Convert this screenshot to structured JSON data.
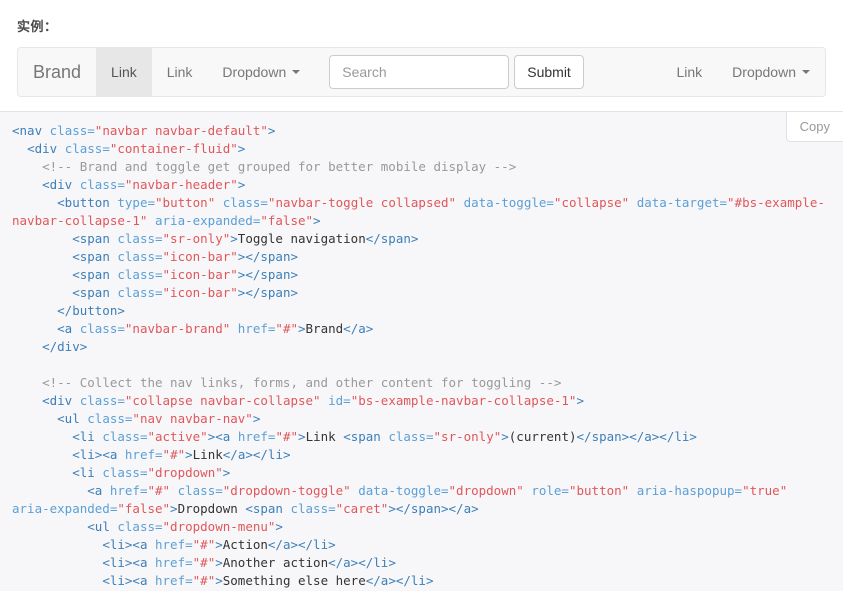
{
  "intro": {
    "label": "实例："
  },
  "navbar": {
    "brand": "Brand",
    "left_items": [
      {
        "label": "Link",
        "active": true,
        "caret": false
      },
      {
        "label": "Link",
        "active": false,
        "caret": false
      },
      {
        "label": "Dropdown",
        "active": false,
        "caret": true
      }
    ],
    "form": {
      "search_placeholder": "Search",
      "search_value": "",
      "submit_label": "Submit"
    },
    "right_items": [
      {
        "label": "Link",
        "active": false,
        "caret": false
      },
      {
        "label": "Dropdown",
        "active": false,
        "caret": true
      }
    ]
  },
  "code_panel": {
    "copy_label": "Copy",
    "language": "html",
    "lines": [
      [
        {
          "t": "tag",
          "s": "<nav "
        },
        {
          "t": "attr",
          "s": "class="
        },
        {
          "t": "val",
          "s": "\"navbar navbar-default\""
        },
        {
          "t": "tag",
          "s": ">"
        }
      ],
      [
        {
          "t": "txt",
          "s": "  "
        },
        {
          "t": "tag",
          "s": "<div "
        },
        {
          "t": "attr",
          "s": "class="
        },
        {
          "t": "val",
          "s": "\"container-fluid\""
        },
        {
          "t": "tag",
          "s": ">"
        }
      ],
      [
        {
          "t": "cmt",
          "s": "    <!-- Brand and toggle get grouped for better mobile display -->"
        }
      ],
      [
        {
          "t": "txt",
          "s": "    "
        },
        {
          "t": "tag",
          "s": "<div "
        },
        {
          "t": "attr",
          "s": "class="
        },
        {
          "t": "val",
          "s": "\"navbar-header\""
        },
        {
          "t": "tag",
          "s": ">"
        }
      ],
      [
        {
          "t": "txt",
          "s": "      "
        },
        {
          "t": "tag",
          "s": "<button "
        },
        {
          "t": "attr",
          "s": "type="
        },
        {
          "t": "val",
          "s": "\"button\""
        },
        {
          "t": "txt",
          "s": " "
        },
        {
          "t": "attr",
          "s": "class="
        },
        {
          "t": "val",
          "s": "\"navbar-toggle collapsed\""
        },
        {
          "t": "txt",
          "s": " "
        },
        {
          "t": "attr",
          "s": "data-toggle="
        },
        {
          "t": "val",
          "s": "\"collapse\""
        },
        {
          "t": "txt",
          "s": " "
        },
        {
          "t": "attr",
          "s": "data-target="
        },
        {
          "t": "val",
          "s": "\"#bs-example-navbar-collapse-1\""
        },
        {
          "t": "txt",
          "s": " "
        },
        {
          "t": "attr",
          "s": "aria-expanded="
        },
        {
          "t": "val",
          "s": "\"false\""
        },
        {
          "t": "tag",
          "s": ">"
        }
      ],
      [
        {
          "t": "txt",
          "s": "        "
        },
        {
          "t": "tag",
          "s": "<span "
        },
        {
          "t": "attr",
          "s": "class="
        },
        {
          "t": "val",
          "s": "\"sr-only\""
        },
        {
          "t": "tag",
          "s": ">"
        },
        {
          "t": "txt",
          "s": "Toggle navigation"
        },
        {
          "t": "tag",
          "s": "</span>"
        }
      ],
      [
        {
          "t": "txt",
          "s": "        "
        },
        {
          "t": "tag",
          "s": "<span "
        },
        {
          "t": "attr",
          "s": "class="
        },
        {
          "t": "val",
          "s": "\"icon-bar\""
        },
        {
          "t": "tag",
          "s": "></span>"
        }
      ],
      [
        {
          "t": "txt",
          "s": "        "
        },
        {
          "t": "tag",
          "s": "<span "
        },
        {
          "t": "attr",
          "s": "class="
        },
        {
          "t": "val",
          "s": "\"icon-bar\""
        },
        {
          "t": "tag",
          "s": "></span>"
        }
      ],
      [
        {
          "t": "txt",
          "s": "        "
        },
        {
          "t": "tag",
          "s": "<span "
        },
        {
          "t": "attr",
          "s": "class="
        },
        {
          "t": "val",
          "s": "\"icon-bar\""
        },
        {
          "t": "tag",
          "s": "></span>"
        }
      ],
      [
        {
          "t": "txt",
          "s": "      "
        },
        {
          "t": "tag",
          "s": "</button>"
        }
      ],
      [
        {
          "t": "txt",
          "s": "      "
        },
        {
          "t": "tag",
          "s": "<a "
        },
        {
          "t": "attr",
          "s": "class="
        },
        {
          "t": "val",
          "s": "\"navbar-brand\""
        },
        {
          "t": "txt",
          "s": " "
        },
        {
          "t": "attr",
          "s": "href="
        },
        {
          "t": "val",
          "s": "\"#\""
        },
        {
          "t": "tag",
          "s": ">"
        },
        {
          "t": "txt",
          "s": "Brand"
        },
        {
          "t": "tag",
          "s": "</a>"
        }
      ],
      [
        {
          "t": "txt",
          "s": "    "
        },
        {
          "t": "tag",
          "s": "</div>"
        }
      ],
      [
        {
          "t": "txt",
          "s": ""
        }
      ],
      [
        {
          "t": "cmt",
          "s": "    <!-- Collect the nav links, forms, and other content for toggling -->"
        }
      ],
      [
        {
          "t": "txt",
          "s": "    "
        },
        {
          "t": "tag",
          "s": "<div "
        },
        {
          "t": "attr",
          "s": "class="
        },
        {
          "t": "val",
          "s": "\"collapse navbar-collapse\""
        },
        {
          "t": "txt",
          "s": " "
        },
        {
          "t": "attr",
          "s": "id="
        },
        {
          "t": "val",
          "s": "\"bs-example-navbar-collapse-1\""
        },
        {
          "t": "tag",
          "s": ">"
        }
      ],
      [
        {
          "t": "txt",
          "s": "      "
        },
        {
          "t": "tag",
          "s": "<ul "
        },
        {
          "t": "attr",
          "s": "class="
        },
        {
          "t": "val",
          "s": "\"nav navbar-nav\""
        },
        {
          "t": "tag",
          "s": ">"
        }
      ],
      [
        {
          "t": "txt",
          "s": "        "
        },
        {
          "t": "tag",
          "s": "<li "
        },
        {
          "t": "attr",
          "s": "class="
        },
        {
          "t": "val",
          "s": "\"active\""
        },
        {
          "t": "tag",
          "s": "><a "
        },
        {
          "t": "attr",
          "s": "href="
        },
        {
          "t": "val",
          "s": "\"#\""
        },
        {
          "t": "tag",
          "s": ">"
        },
        {
          "t": "txt",
          "s": "Link "
        },
        {
          "t": "tag",
          "s": "<span "
        },
        {
          "t": "attr",
          "s": "class="
        },
        {
          "t": "val",
          "s": "\"sr-only\""
        },
        {
          "t": "tag",
          "s": ">"
        },
        {
          "t": "txt",
          "s": "(current)"
        },
        {
          "t": "tag",
          "s": "</span></a></li>"
        }
      ],
      [
        {
          "t": "txt",
          "s": "        "
        },
        {
          "t": "tag",
          "s": "<li><a "
        },
        {
          "t": "attr",
          "s": "href="
        },
        {
          "t": "val",
          "s": "\"#\""
        },
        {
          "t": "tag",
          "s": ">"
        },
        {
          "t": "txt",
          "s": "Link"
        },
        {
          "t": "tag",
          "s": "</a></li>"
        }
      ],
      [
        {
          "t": "txt",
          "s": "        "
        },
        {
          "t": "tag",
          "s": "<li "
        },
        {
          "t": "attr",
          "s": "class="
        },
        {
          "t": "val",
          "s": "\"dropdown\""
        },
        {
          "t": "tag",
          "s": ">"
        }
      ],
      [
        {
          "t": "txt",
          "s": "          "
        },
        {
          "t": "tag",
          "s": "<a "
        },
        {
          "t": "attr",
          "s": "href="
        },
        {
          "t": "val",
          "s": "\"#\""
        },
        {
          "t": "txt",
          "s": " "
        },
        {
          "t": "attr",
          "s": "class="
        },
        {
          "t": "val",
          "s": "\"dropdown-toggle\""
        },
        {
          "t": "txt",
          "s": " "
        },
        {
          "t": "attr",
          "s": "data-toggle="
        },
        {
          "t": "val",
          "s": "\"dropdown\""
        },
        {
          "t": "txt",
          "s": " "
        },
        {
          "t": "attr",
          "s": "role="
        },
        {
          "t": "val",
          "s": "\"button\""
        },
        {
          "t": "txt",
          "s": " "
        },
        {
          "t": "attr",
          "s": "aria-haspopup="
        },
        {
          "t": "val",
          "s": "\"true\""
        },
        {
          "t": "txt",
          "s": " "
        },
        {
          "t": "attr",
          "s": "aria-expanded="
        },
        {
          "t": "val",
          "s": "\"false\""
        },
        {
          "t": "tag",
          "s": ">"
        },
        {
          "t": "txt",
          "s": "Dropdown "
        },
        {
          "t": "tag",
          "s": "<span "
        },
        {
          "t": "attr",
          "s": "class="
        },
        {
          "t": "val",
          "s": "\"caret\""
        },
        {
          "t": "tag",
          "s": "></span></a>"
        }
      ],
      [
        {
          "t": "txt",
          "s": "          "
        },
        {
          "t": "tag",
          "s": "<ul "
        },
        {
          "t": "attr",
          "s": "class="
        },
        {
          "t": "val",
          "s": "\"dropdown-menu\""
        },
        {
          "t": "tag",
          "s": ">"
        }
      ],
      [
        {
          "t": "txt",
          "s": "            "
        },
        {
          "t": "tag",
          "s": "<li><a "
        },
        {
          "t": "attr",
          "s": "href="
        },
        {
          "t": "val",
          "s": "\"#\""
        },
        {
          "t": "tag",
          "s": ">"
        },
        {
          "t": "txt",
          "s": "Action"
        },
        {
          "t": "tag",
          "s": "</a></li>"
        }
      ],
      [
        {
          "t": "txt",
          "s": "            "
        },
        {
          "t": "tag",
          "s": "<li><a "
        },
        {
          "t": "attr",
          "s": "href="
        },
        {
          "t": "val",
          "s": "\"#\""
        },
        {
          "t": "tag",
          "s": ">"
        },
        {
          "t": "txt",
          "s": "Another action"
        },
        {
          "t": "tag",
          "s": "</a></li>"
        }
      ],
      [
        {
          "t": "txt",
          "s": "            "
        },
        {
          "t": "tag",
          "s": "<li><a "
        },
        {
          "t": "attr",
          "s": "href="
        },
        {
          "t": "val",
          "s": "\"#\""
        },
        {
          "t": "tag",
          "s": ">"
        },
        {
          "t": "txt",
          "s": "Something else here"
        },
        {
          "t": "tag",
          "s": "</a></li>"
        }
      ]
    ]
  },
  "colors": {
    "page_bg": "#ffffff",
    "navbar_bg": "#f8f8f8",
    "navbar_border": "#e7e7e7",
    "navbar_active_bg": "#e7e7e7",
    "nav_text": "#777777",
    "code_bg": "#f7f7f9",
    "code_border": "#e1e1e8",
    "syntax_tag": "#3d7fb8",
    "syntax_attr": "#5c9fd6",
    "syntax_value": "#e0575b",
    "syntax_text": "#333333",
    "syntax_comment": "#999999"
  }
}
